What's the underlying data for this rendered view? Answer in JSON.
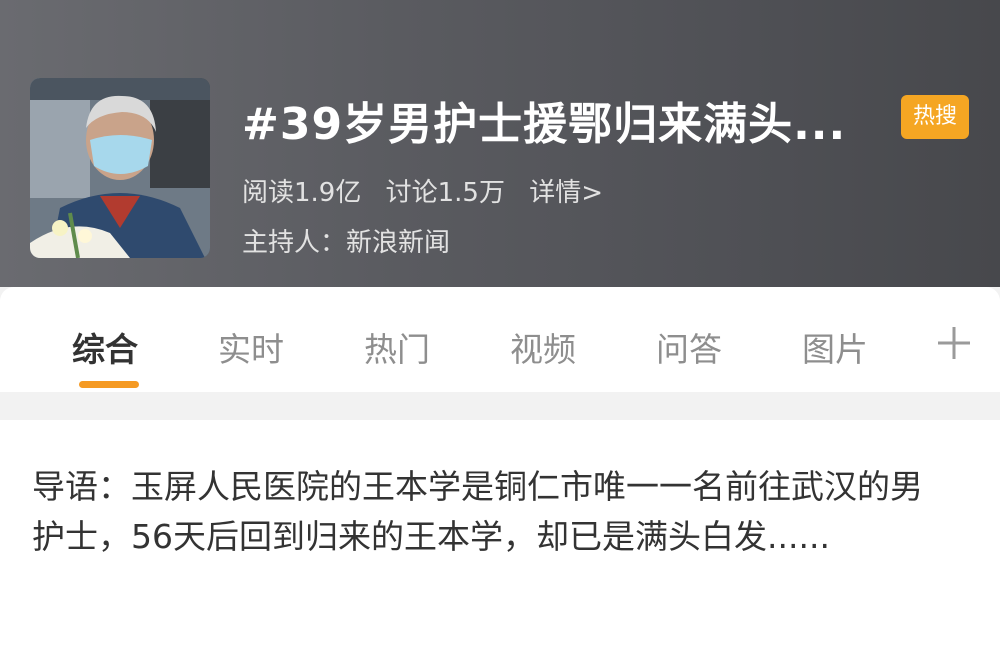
{
  "header": {
    "title": "#39岁男护士援鄂归来满头...",
    "badge": "热搜",
    "stats": {
      "read": "阅读1.9亿",
      "discuss": "讨论1.5万",
      "details": "详情>"
    },
    "host": "主持人：新浪新闻"
  },
  "tabs": [
    {
      "label": "综合",
      "active": true
    },
    {
      "label": "实时",
      "active": false
    },
    {
      "label": "热门",
      "active": false
    },
    {
      "label": "视频",
      "active": false
    },
    {
      "label": "问答",
      "active": false
    },
    {
      "label": "图片",
      "active": false
    }
  ],
  "intro": "导语：玉屏人民医院的王本学是铜仁市唯一一名前往武汉的男护士，56天后回到归来的王本学，却已是满头白发......",
  "colors": {
    "badge": "#f5a623",
    "active_tab_underline": "#f59a23"
  },
  "icons": {
    "add": "plus-icon"
  }
}
